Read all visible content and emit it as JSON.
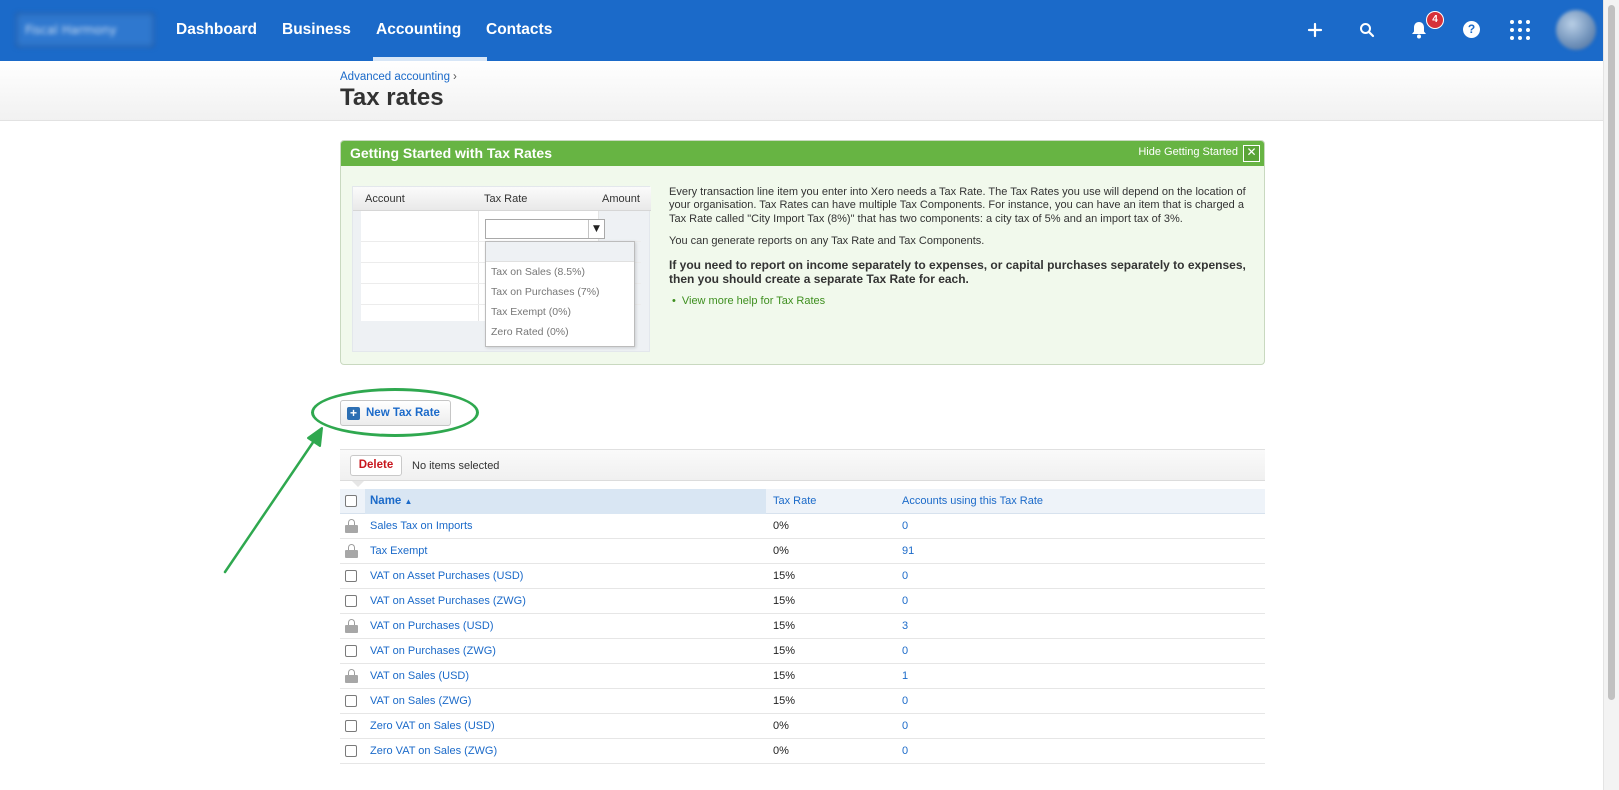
{
  "nav": {
    "org_name": "Fiscal Harmony",
    "items": [
      {
        "label": "Dashboard"
      },
      {
        "label": "Business"
      },
      {
        "label": "Accounting"
      },
      {
        "label": "Contacts"
      }
    ],
    "active": "Accounting",
    "notification_count": "4",
    "icons": [
      "plus-icon",
      "search-icon",
      "bell-icon",
      "help-icon",
      "apps-grid-icon",
      "avatar"
    ],
    "brand_color": "#1b6ac9"
  },
  "header": {
    "breadcrumb": "Advanced accounting",
    "breadcrumb_sep": "›",
    "title": "Tax rates"
  },
  "getting_started": {
    "title": "Getting Started with Tax Rates",
    "hide_label": "Hide Getting Started",
    "close_glyph": "✕",
    "demo": {
      "columns": [
        "Account",
        "Tax Rate",
        "Amount"
      ],
      "options": [
        "Tax on Sales (8.5%)",
        "Tax on Purchases (7%)",
        "Tax Exempt (0%)",
        "Zero Rated (0%)"
      ]
    },
    "paragraph1": "Every transaction line item you enter into Xero needs a Tax Rate. The Tax Rates you use will depend on the location of your organisation. Tax Rates can have multiple Tax Components. For instance, you can have an item that is charged a Tax Rate called \"City Import Tax (8%)\" that has two components: a city tax of 5% and an import tax of 3%.",
    "paragraph2": "You can generate reports on any Tax Rate and Tax Components.",
    "paragraph3": "If you need to report on income separately to expenses, or capital purchases separately to expenses, then you should create a separate Tax Rate for each.",
    "help_link": "View more help for Tax Rates",
    "accent_color": "#67b443"
  },
  "actions": {
    "new_tax_rate": "New Tax Rate",
    "delete": "Delete",
    "selection_status": "No items selected"
  },
  "table": {
    "headers": {
      "name": "Name",
      "sort_indicator": "▲",
      "tax_rate": "Tax Rate",
      "accounts": "Accounts using this Tax Rate"
    },
    "rows": [
      {
        "name": "Sales Tax on Imports",
        "rate": "0%",
        "accounts": "0",
        "locked": true
      },
      {
        "name": "Tax Exempt",
        "rate": "0%",
        "accounts": "91",
        "locked": true
      },
      {
        "name": "VAT on Asset Purchases (USD)",
        "rate": "15%",
        "accounts": "0",
        "locked": false
      },
      {
        "name": "VAT on Asset Purchases (ZWG)",
        "rate": "15%",
        "accounts": "0",
        "locked": false
      },
      {
        "name": "VAT on Purchases (USD)",
        "rate": "15%",
        "accounts": "3",
        "locked": true
      },
      {
        "name": "VAT on Purchases (ZWG)",
        "rate": "15%",
        "accounts": "0",
        "locked": false
      },
      {
        "name": "VAT on Sales (USD)",
        "rate": "15%",
        "accounts": "1",
        "locked": true
      },
      {
        "name": "VAT on Sales (ZWG)",
        "rate": "15%",
        "accounts": "0",
        "locked": false
      },
      {
        "name": "Zero VAT on Sales (USD)",
        "rate": "0%",
        "accounts": "0",
        "locked": false
      },
      {
        "name": "Zero VAT on Sales (ZWG)",
        "rate": "0%",
        "accounts": "0",
        "locked": false
      }
    ]
  },
  "annotation": {
    "color": "#2fa84f"
  }
}
